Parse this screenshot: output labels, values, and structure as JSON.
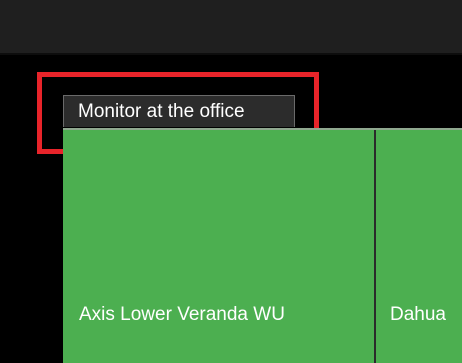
{
  "monitor": {
    "tab_label": "Monitor at the office"
  },
  "cameras": [
    {
      "label": "Axis Lower Veranda WU"
    },
    {
      "label": "Dahua"
    }
  ],
  "colors": {
    "background": "#000000",
    "top_bar": "#1f1f1f",
    "tile": "#4caf50",
    "highlight": "#e8242a"
  }
}
